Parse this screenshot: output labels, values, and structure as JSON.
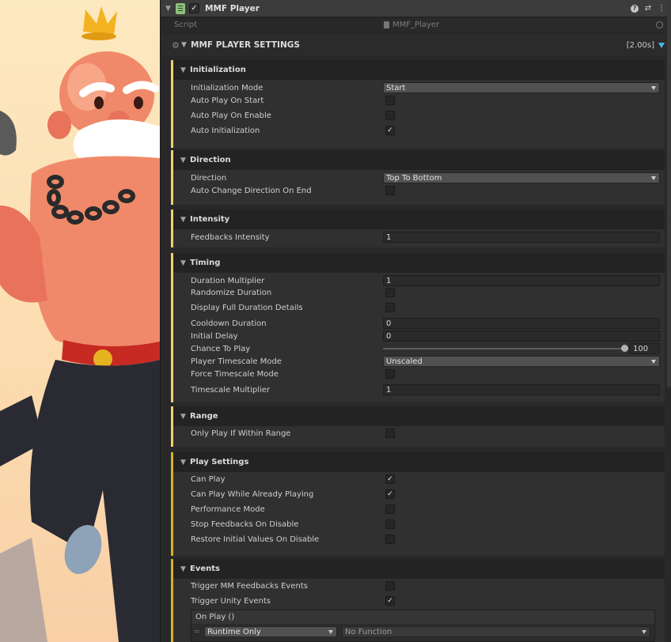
{
  "component": {
    "title": "MMF Player",
    "enabled": true
  },
  "script_row": {
    "label": "Script",
    "value": "MMF_Player"
  },
  "settings": {
    "title": "MMF PLAYER SETTINGS",
    "duration": "[2.00s]"
  },
  "groups": {
    "initialization": {
      "title": "Initialization",
      "initialization_mode": {
        "label": "Initialization Mode",
        "value": "Start"
      },
      "auto_play_on_start": {
        "label": "Auto Play On Start",
        "checked": false
      },
      "auto_play_on_enable": {
        "label": "Auto Play On Enable",
        "checked": false
      },
      "auto_initialization": {
        "label": "Auto Initialization",
        "checked": true
      }
    },
    "direction": {
      "title": "Direction",
      "direction": {
        "label": "Direction",
        "value": "Top To Bottom"
      },
      "auto_change": {
        "label": "Auto Change Direction On End",
        "checked": false
      }
    },
    "intensity": {
      "title": "Intensity",
      "feedbacks_intensity": {
        "label": "Feedbacks Intensity",
        "value": "1"
      }
    },
    "timing": {
      "title": "Timing",
      "duration_multiplier": {
        "label": "Duration Multiplier",
        "value": "1"
      },
      "randomize_duration": {
        "label": "Randomize Duration",
        "checked": false
      },
      "display_full": {
        "label": "Display Full Duration Details",
        "checked": false
      },
      "cooldown_duration": {
        "label": "Cooldown Duration",
        "value": "0"
      },
      "initial_delay": {
        "label": "Initial Delay",
        "value": "0"
      },
      "chance_to_play": {
        "label": "Chance To Play",
        "value": "100",
        "fraction": 1.0
      },
      "player_timescale_mode": {
        "label": "Player Timescale Mode",
        "value": "Unscaled"
      },
      "force_timescale_mode": {
        "label": "Force Timescale Mode",
        "checked": false
      },
      "timescale_multiplier": {
        "label": "Timescale Multiplier",
        "value": "1"
      }
    },
    "range": {
      "title": "Range",
      "only_play_in_range": {
        "label": "Only Play If Within Range",
        "checked": false
      }
    },
    "play_settings": {
      "title": "Play Settings",
      "can_play": {
        "label": "Can Play",
        "checked": true
      },
      "can_play_while_playing": {
        "label": "Can Play While Already Playing",
        "checked": true
      },
      "performance_mode": {
        "label": "Performance Mode",
        "checked": false
      },
      "stop_on_disable": {
        "label": "Stop Feedbacks On Disable",
        "checked": false
      },
      "restore_on_disable": {
        "label": "Restore Initial Values On Disable",
        "checked": false
      }
    },
    "events": {
      "title": "Events",
      "trigger_mm": {
        "label": "Trigger MM Feedbacks Events",
        "checked": false
      },
      "trigger_unity": {
        "label": "Trigger Unity Events",
        "checked": true
      },
      "on_play": {
        "header": "On Play ()",
        "runtime": "Runtime Only",
        "function": "No Function"
      }
    }
  },
  "colors": {
    "accent_yellow": "#d9b024",
    "accent_light_yellow": "#f0d070",
    "accent_blue": "#4ab8e8",
    "background": "#282828"
  },
  "check_glyph": "✓"
}
